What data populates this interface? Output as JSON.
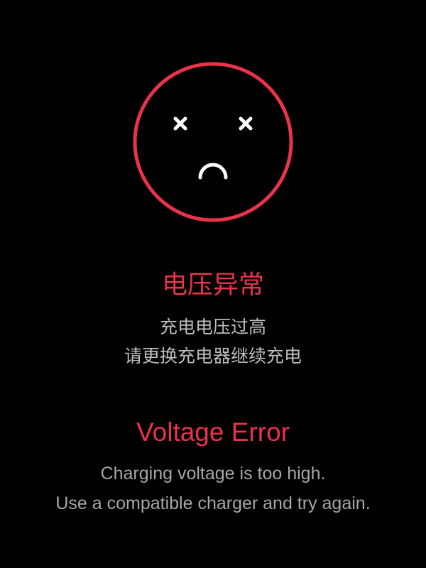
{
  "error": {
    "icon": "dead-face-icon",
    "title_cn": "电压异常",
    "message_cn": [
      "充电电压过高",
      "请更换充电器继续充电"
    ],
    "title_en": "Voltage Error",
    "message_en": [
      "Charging voltage is too high.",
      "Use a compatible charger and try again."
    ]
  },
  "colors": {
    "background": "#000000",
    "accent": "#E8334A",
    "icon_features": "#FFFFFF",
    "message_cn": "#BDBDBD",
    "message_en": "#A6A6A6"
  }
}
